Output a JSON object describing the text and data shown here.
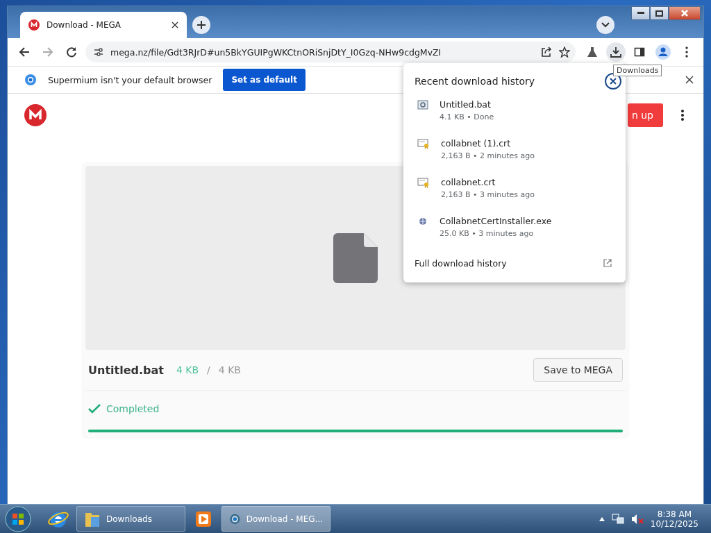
{
  "tabs": [
    {
      "title": "Download - MEGA",
      "selected": true
    }
  ],
  "address": {
    "url": "mega.nz/file/Gdt3RJrD#un5BkYGUIPgWKCtnORiSnjDtY_I0Gzq-NHw9cdgMvZI"
  },
  "tooltip": "Downloads",
  "infobar": {
    "message": "Supermium isn't your default browser",
    "button": "Set as default"
  },
  "page": {
    "signup_button": "n up",
    "file_name": "Untitled.bat",
    "downloaded": "4 KB",
    "separator": "/",
    "total": "4 KB",
    "save_button": "Save to MEGA",
    "status": "Completed",
    "level": 1
  },
  "downloads_popup": {
    "title": "Recent download history",
    "items": [
      {
        "name": "Untitled.bat",
        "details": "4.1 KB • Done",
        "kind": "script"
      },
      {
        "name": "collabnet (1).crt",
        "details": "2,163 B • 2 minutes ago",
        "kind": "certificate"
      },
      {
        "name": "collabnet.crt",
        "details": "2,163 B • 3 minutes ago",
        "kind": "certificate"
      },
      {
        "name": "CollabnetCertInstaller.exe",
        "details": "25.0 KB • 3 minutes ago",
        "kind": "program"
      }
    ],
    "footer": "Full download history"
  },
  "taskbar": {
    "items": [
      {
        "kind": "web",
        "selected": false
      },
      {
        "kind": "folder",
        "label": "Downloads",
        "selected": false
      },
      {
        "kind": "media",
        "selected": false
      },
      {
        "kind": "browser",
        "label": "Download - MEG...",
        "selected": true
      }
    ],
    "time": "8:38 AM",
    "date": "10/12/2025"
  }
}
